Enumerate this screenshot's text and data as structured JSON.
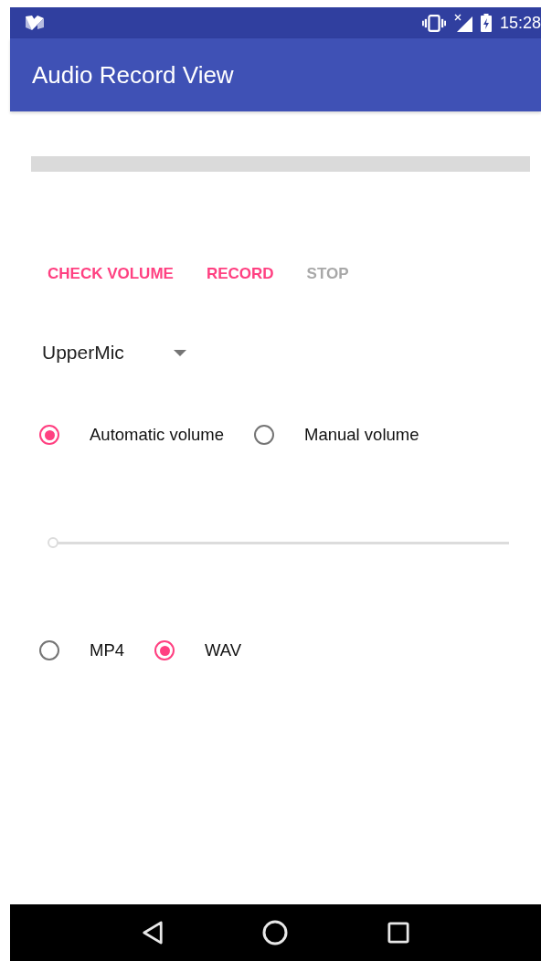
{
  "status_bar": {
    "time": "15:28"
  },
  "app_bar": {
    "title": "Audio Record View"
  },
  "progress": {
    "level": 0
  },
  "buttons": [
    {
      "label": "CHECK VOLUME",
      "disabled": false
    },
    {
      "label": "RECORD",
      "disabled": false
    },
    {
      "label": "STOP",
      "disabled": true
    }
  ],
  "spinner": {
    "value": "UpperMic"
  },
  "volume_mode": [
    {
      "label": "Automatic volume",
      "selected": true
    },
    {
      "label": "Manual volume",
      "selected": false
    }
  ],
  "volume_slider": {
    "level": 0,
    "disabled": true
  },
  "format": [
    {
      "label": "MP4",
      "selected": false
    },
    {
      "label": "WAV",
      "selected": true
    }
  ]
}
